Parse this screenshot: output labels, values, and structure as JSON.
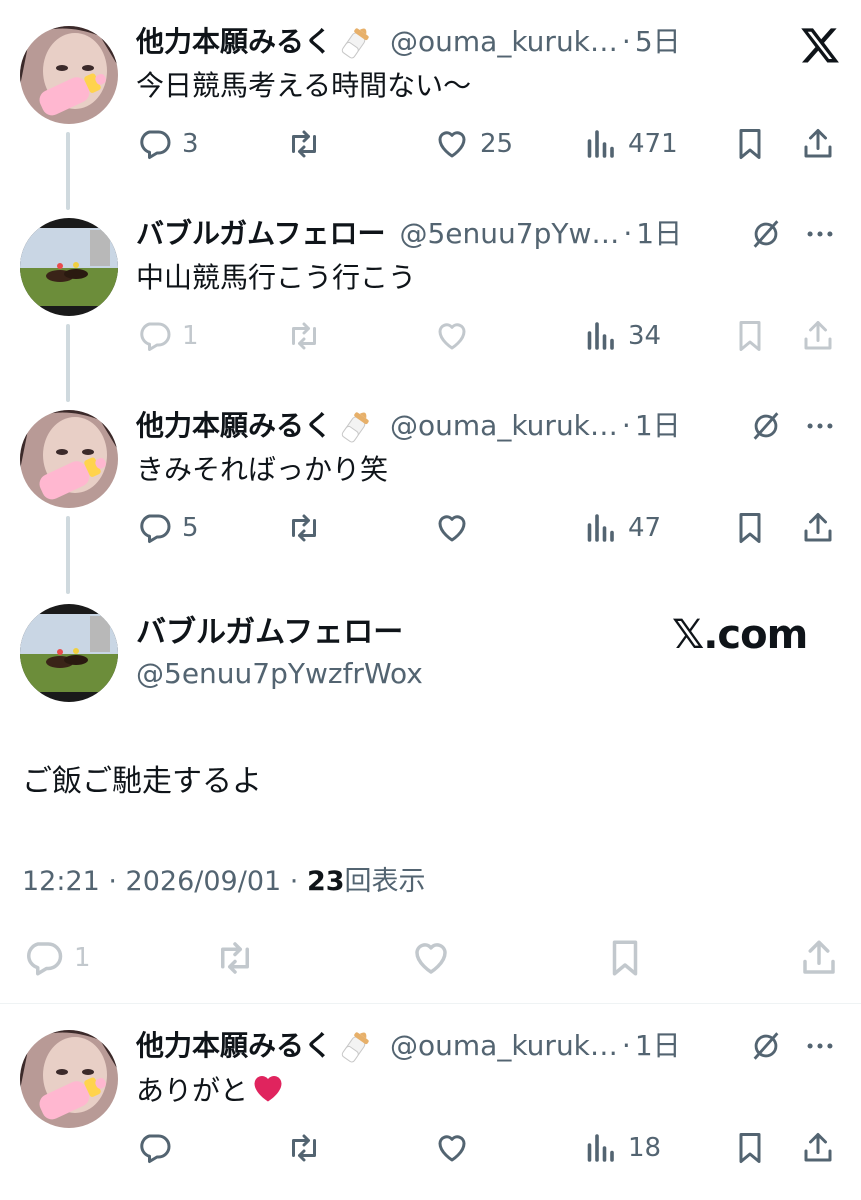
{
  "tweets": [
    {
      "name": "他力本願みるく",
      "handle": "@ouma_kuruk…",
      "time": "5日",
      "text": "今日競馬考える時間ない〜",
      "replies": "3",
      "retweets": "",
      "likes": "25",
      "views": "471"
    },
    {
      "name": "バブルガムフェロー",
      "handle": "@5enuu7pYw…",
      "time": "1日",
      "text": "中山競馬行こう行こう",
      "replies": "1",
      "retweets": "",
      "likes": "",
      "views": "34"
    },
    {
      "name": "他力本願みるく",
      "handle": "@ouma_kuruk…",
      "time": "1日",
      "text": "きみそればっかり笑",
      "replies": "5",
      "retweets": "",
      "likes": "",
      "views": "47"
    }
  ],
  "main": {
    "name": "バブルガムフェロー",
    "handle": "@5enuu7pYwzfrWox",
    "watermark": "𝕏.com",
    "text": "ご飯ご馳走するよ",
    "timestamp": "12:21 · 2026/09/01 · ",
    "views_count": "23",
    "views_label": "回表示",
    "replies": "1"
  },
  "reply": {
    "name": "他力本願みるく",
    "handle": "@ouma_kuruk…",
    "time": "1日",
    "text": "ありがと",
    "views": "18"
  },
  "separator": "·",
  "colors": {
    "text": "#0f1419",
    "secondary": "#536471",
    "thread_line": "#cfd9de",
    "heart": "#e0245e"
  }
}
